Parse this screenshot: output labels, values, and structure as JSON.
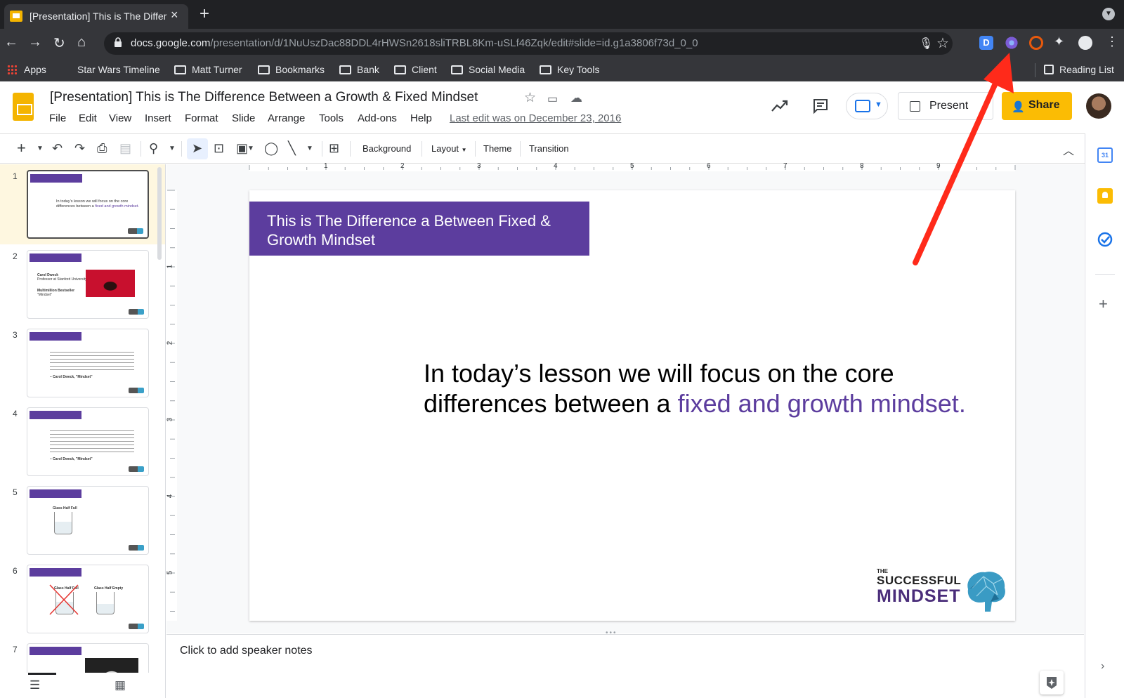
{
  "browser": {
    "tab_title": "[Presentation] This is The Difference Between a Growth & Fixed Mindset",
    "url_host": "docs.google.com",
    "url_path": "/presentation/d/1NuUszDac88DDL4rHWSn2618sliTRBL8Km-uSLf46Zqk/edit#slide=id.g1a3806f73d_0_0",
    "bookmarks": {
      "apps": "Apps",
      "items": [
        "Star Wars Timeline",
        "Matt Turner",
        "Bookmarks",
        "Bank",
        "Client",
        "Social Media",
        "Key Tools"
      ],
      "reading_list": "Reading List"
    },
    "extension_d_label": "D"
  },
  "doc": {
    "title": "[Presentation] This is The Difference Between a Growth & Fixed Mindset",
    "menu": [
      "File",
      "Edit",
      "View",
      "Insert",
      "Format",
      "Slide",
      "Arrange",
      "Tools",
      "Add-ons",
      "Help"
    ],
    "last_edit": "Last edit was on December 23, 2016",
    "present_label": "Present",
    "share_label": "Share"
  },
  "toolbar": {
    "background": "Background",
    "layout": "Layout",
    "theme": "Theme",
    "transition": "Transition"
  },
  "ruler": {
    "h_numbers": [
      "1",
      "2",
      "3",
      "4",
      "5",
      "6",
      "7",
      "8",
      "9"
    ],
    "v_numbers": [
      "1",
      "2",
      "3",
      "4",
      "5"
    ]
  },
  "filmstrip": {
    "slide_numbers": [
      "1",
      "2",
      "3",
      "4",
      "5",
      "6",
      "7"
    ],
    "slide2_name": "Carol Dweck",
    "slide2_role": "Professor at Stanford University",
    "slide2_bestseller": "Multimillion Bestseller",
    "slide2_book": "\"Mindset\"",
    "slide5_caption": "Glass Half Full",
    "slide6_caption_left": "Glass Half Full",
    "slide6_caption_right": "Glass Half Empty",
    "slide3_attr": "– Carol Dweck, \"Mindset\"",
    "slide4_attr": "– Carol Dweck, \"Mindset\""
  },
  "slide": {
    "title": "This is The  Difference a Between Fixed & Growth Mindset",
    "body_plain": "In today’s lesson we will focus on the core differences between a ",
    "body_highlight": "fixed and growth mindset.",
    "logo_the": "THE",
    "logo_successful": "SUCCESSFUL",
    "logo_mindset": "MINDSET"
  },
  "notes": {
    "placeholder": "Click to add speaker notes"
  },
  "colors": {
    "accent_purple": "#5c3d9e",
    "share_yellow": "#fbbc04",
    "annotation_red": "#ff2a1a"
  }
}
